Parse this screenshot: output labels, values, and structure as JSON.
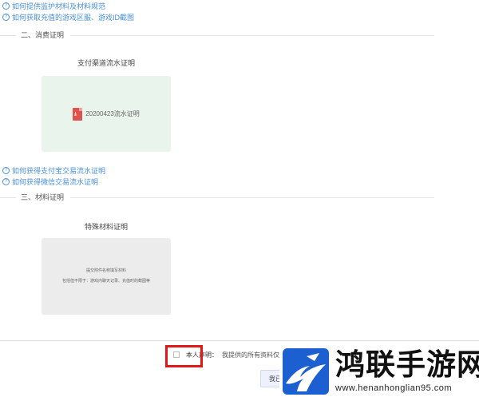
{
  "help_links_top": [
    {
      "icon": "question-circle-icon",
      "label": "如何提供监护材料及材料规范"
    },
    {
      "icon": "question-circle-icon",
      "label": "如何获取充值的游戏区服、游戏ID截图"
    }
  ],
  "sections": {
    "consumption": {
      "title": "二、消费证明",
      "card_label": "支付渠道流水证明",
      "file_name": "20200423流水证明",
      "file_icon": "pdf-icon",
      "file_icon_glyph": "⤓"
    },
    "materials": {
      "title": "三、材料证明",
      "card_label": "特殊材料证明",
      "placeholder_line1": "提交附件名称填写材料",
      "placeholder_line2": "包括但不限于：游戏内聊天记录、充值时的截图等"
    }
  },
  "help_links_middle": [
    {
      "icon": "question-circle-icon",
      "label": "如何获得支付宝交易流水证明"
    },
    {
      "icon": "question-circle-icon",
      "label": "如何获得微信交易流水证明"
    }
  ],
  "declaration": {
    "label": "本人声明：",
    "text": "我提供的所有资料仅"
  },
  "submit": {
    "label": "我已"
  },
  "watermark": {
    "title": "鸿联手游网",
    "url": "www.henanhonglian95.com"
  },
  "colors": {
    "link": "#4a90d9",
    "highlight": "#e01818",
    "green_card": "#e8f4ec",
    "pdf": "#e0524e"
  }
}
